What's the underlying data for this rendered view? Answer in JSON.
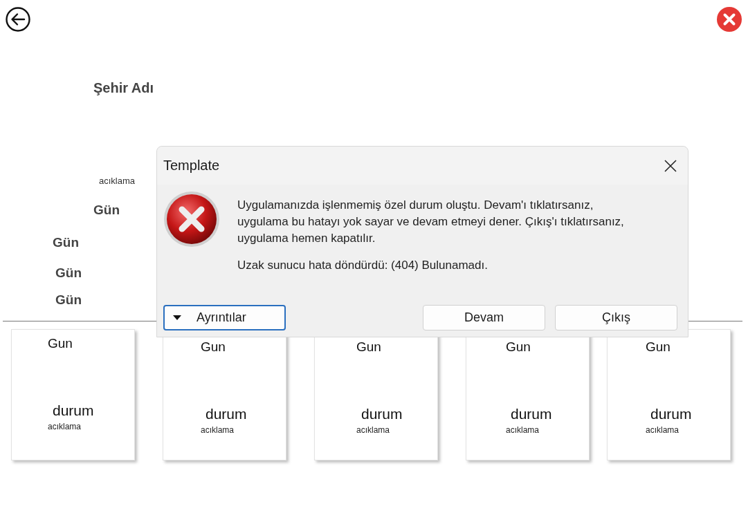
{
  "city_title": "Şehir Adı",
  "left_labels": [
    {
      "kind": "caption",
      "text": "acıklama"
    },
    {
      "kind": "day",
      "text": "Gün"
    },
    {
      "kind": "day",
      "text": "Gün"
    },
    {
      "kind": "day",
      "text": "Gün"
    },
    {
      "kind": "day",
      "text": "Gün"
    }
  ],
  "dialog": {
    "title": "Template",
    "message": "Uygulamanızda işlenmemiş özel durum oluştu. Devam'ı tıklatırsanız, uygulama bu hatayı yok sayar ve devam etmeyi dener. Çıkış'ı tıklatırsanız, uygulama hemen kapatılır.",
    "detail": "Uzak sunucu hata döndürdü: (404) Bulunamadı.",
    "details_button": "Ayrıntılar",
    "buttons": [
      "Devam",
      "Çıkış"
    ]
  },
  "cards": [
    {
      "day": "Gun",
      "status": "durum",
      "description": "acıklama"
    },
    {
      "day": "Gun",
      "status": "durum",
      "description": "acıklama"
    },
    {
      "day": "Gun",
      "status": "durum",
      "description": "acıklama"
    },
    {
      "day": "Gun",
      "status": "durum",
      "description": "acıklama"
    },
    {
      "day": "Gun",
      "status": "durum",
      "description": "acıklama"
    }
  ]
}
